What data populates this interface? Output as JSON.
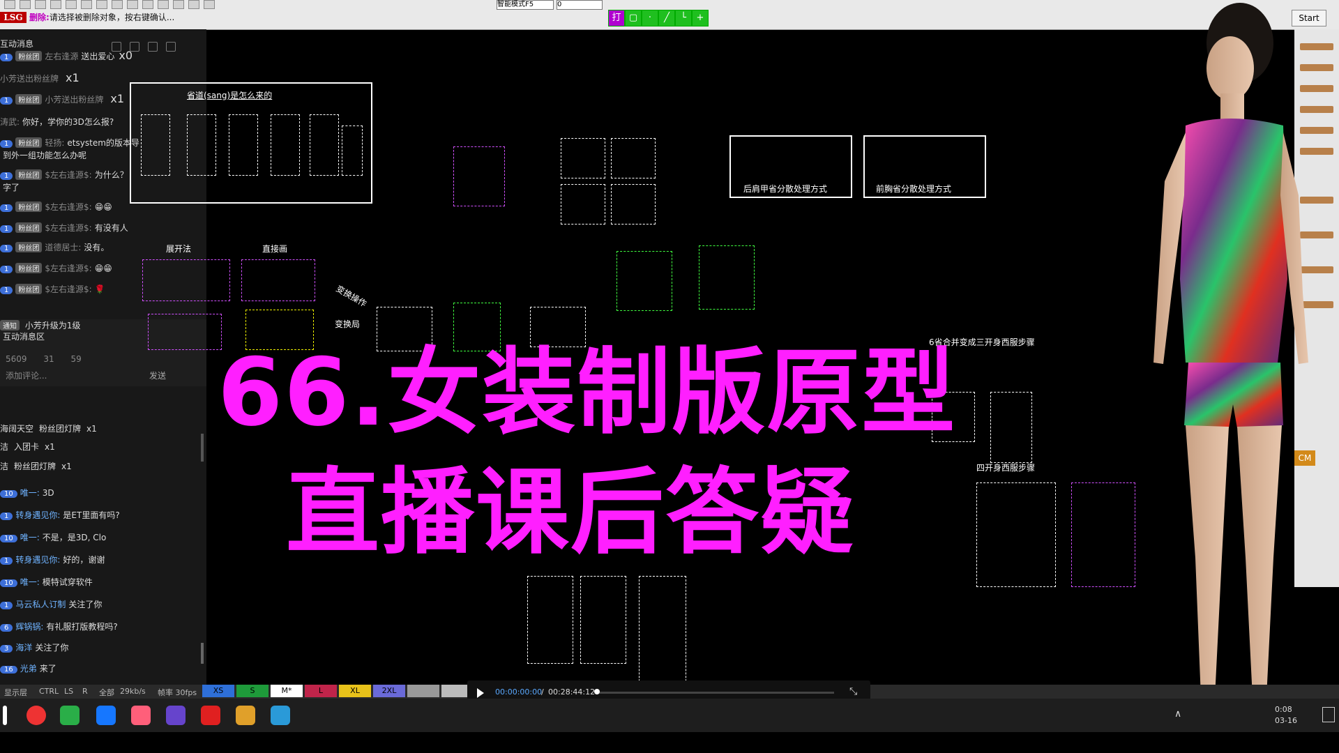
{
  "toolbar": {
    "logo": "LSG",
    "hint_action": "删除:",
    "hint_text": "请选择被删除对象，按右键确认...",
    "mode_select": "智能模式F5",
    "mode_value": "0",
    "green_first": "打",
    "start_label": "Start"
  },
  "chat": {
    "title": "互动消息",
    "messages": [
      {
        "level": "1",
        "user": "左右逢源",
        "text": "送出爱心",
        "extra": "x0"
      },
      {
        "level": "",
        "user": "小芳送出粉丝牌",
        "text": "",
        "extra": "x1"
      },
      {
        "level": "1",
        "user": "小芳送出粉丝牌",
        "text": "",
        "extra": "x1"
      },
      {
        "level": "",
        "user": "涛武:",
        "text": "你好，学你的3D怎么报?",
        "extra": ""
      },
      {
        "level": "1",
        "user": "轻扬:",
        "text": "etsystem的版本导",
        "extra": ""
      },
      {
        "level": "",
        "user": "",
        "text": "到外一组功能怎么办呢",
        "extra": ""
      },
      {
        "level": "1",
        "user": "$左右逢源$:",
        "text": "为什么？",
        "extra": ""
      },
      {
        "level": "",
        "user": "",
        "text": "字了",
        "extra": ""
      },
      {
        "level": "1",
        "user": "$左右逢源$:",
        "text": "😁😁",
        "extra": ""
      },
      {
        "level": "1",
        "user": "$左右逢源$:",
        "text": "有没有人",
        "extra": ""
      },
      {
        "level": "1",
        "user": "道德居士:",
        "text": "没有。",
        "extra": ""
      },
      {
        "level": "1",
        "user": "$左右逢源$:",
        "text": "😁😁",
        "extra": ""
      },
      {
        "level": "1",
        "user": "$左右逢源$:",
        "text": "🌹",
        "extra": ""
      }
    ],
    "notice_label": "通知",
    "notice_text": "小芳升级为1级",
    "area_label": "互动消息区",
    "stats": [
      "5609",
      "31",
      "59"
    ],
    "input_placeholder": "添加评论...",
    "send_label": "发送",
    "gifts": [
      {
        "user": "海阔天空",
        "item": "粉丝团灯牌",
        "count": "x1"
      },
      {
        "user": "洁",
        "item": "入团卡",
        "count": "x1"
      },
      {
        "user": "洁",
        "item": "粉丝团灯牌",
        "count": "x1"
      }
    ],
    "lower_messages": [
      {
        "level": "10",
        "user": "唯一:",
        "text": "3D"
      },
      {
        "level": "1",
        "user": "转身遇见你:",
        "text": "是ET里面有吗?"
      },
      {
        "level": "10",
        "user": "唯一:",
        "text": "不是，是3D, Clo"
      },
      {
        "level": "1",
        "user": "转身遇见你:",
        "text": "好的，谢谢"
      },
      {
        "level": "10",
        "user": "唯一:",
        "text": "模特试穿软件"
      },
      {
        "level": "1",
        "user": "马云私人订制",
        "text": "关注了你"
      },
      {
        "level": "6",
        "user": "辉锅锅:",
        "text": "有礼服打版教程吗?"
      },
      {
        "level": "3",
        "user": "海洋",
        "text": "关注了你"
      },
      {
        "level": "16",
        "user": "光弟",
        "text": "来了"
      }
    ]
  },
  "cad": {
    "box_title": "省道(sang)是怎么来的",
    "label_unfold": "展开法",
    "label_direct": "直接画",
    "label_back": "后肩甲省分散处理方式",
    "label_front": "前胸省分散处理方式",
    "label_change1": "变换操作",
    "label_change2": "变换局",
    "label_sideways": "6省合并变成三开身西服步骤",
    "label_four": "四开身西服步骤"
  },
  "overlay": {
    "line1": "66.女装制版原型",
    "line2": "直播课后答疑"
  },
  "statusbar": {
    "display": "显示层",
    "ctrl": "CTRL",
    "ls": "LS",
    "r": "R",
    "all": "全部",
    "speed": "29kb/s",
    "fps": "帧率 30fps"
  },
  "sizes": [
    {
      "label": "XS",
      "color": "#2e6fd8"
    },
    {
      "label": "S",
      "color": "#1e9a3a"
    },
    {
      "label": "M*",
      "color": "#ffffff"
    },
    {
      "label": "L",
      "color": "#c0244a"
    },
    {
      "label": "XL",
      "color": "#e8c21a"
    },
    {
      "label": "2XL",
      "color": "#6a6ad8"
    },
    {
      "label": "",
      "color": "#999999"
    },
    {
      "label": "",
      "color": "#bbbbbb"
    }
  ],
  "player": {
    "current": "00:00:00:00",
    "separator": "/",
    "total": "00:28:44:12"
  },
  "taskbar": {
    "time": "0:08",
    "date": "03-16"
  },
  "palette_label": "CM"
}
